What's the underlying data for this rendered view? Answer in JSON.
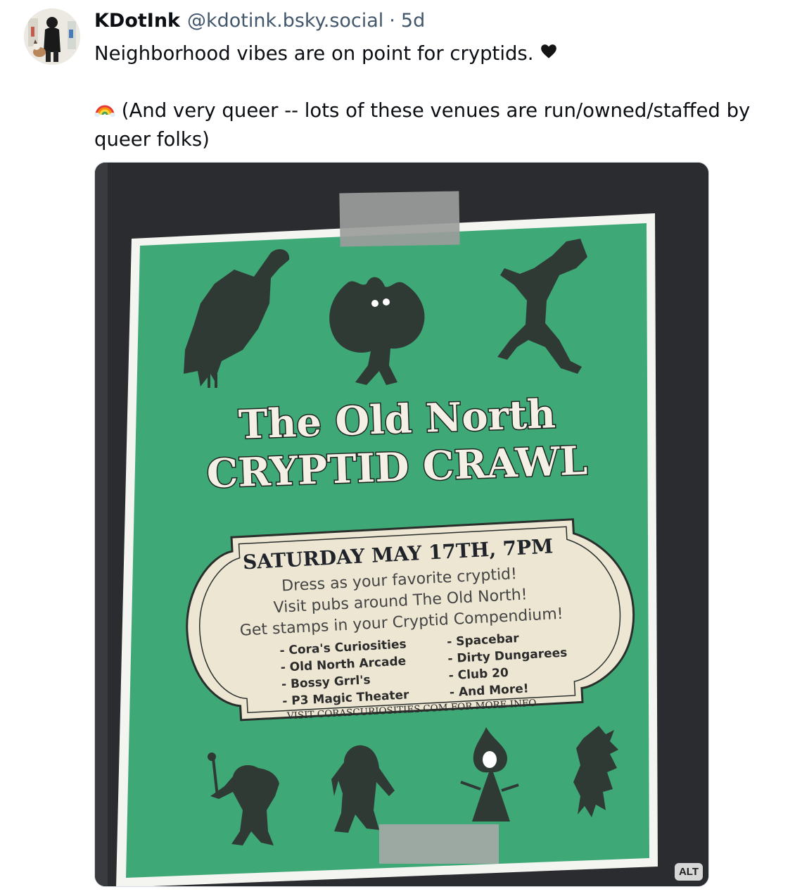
{
  "post": {
    "author_name": "KDotInk",
    "author_handle": "@kdotink.bsky.social",
    "separator": "·",
    "timestamp": "5d",
    "lines": [
      "Neighborhood vibes are on point for cryptids.",
      "(And very queer -- lots of these venues are run/owned/staffed by",
      "queer folks)"
    ],
    "heart_emoji_icon": "black-heart-icon",
    "rainbow_emoji_icon": "rainbow-icon"
  },
  "image": {
    "alt_badge": "ALT",
    "poster": {
      "title_line1": "The Old North",
      "title_line2": "CRYPTID CRAWL",
      "date_line": "SATURDAY MAY 17TH, 7PM",
      "lines": [
        "Dress as your favorite cryptid!",
        "Visit pubs around The Old North!",
        "Get stamps in your Cryptid Compendium!"
      ],
      "venues_left": [
        "- Cora's Curiosities",
        "- Old North Arcade",
        "- Bossy Grrl's",
        "- P3 Magic Theater"
      ],
      "venues_right": [
        "- Spacebar",
        "- Dirty Dungarees",
        "- Club 20",
        "- And More!"
      ],
      "footer": "VISIT CORASCURIOSITIES.COM FOR MORE INFO"
    },
    "colors": {
      "poster_green": "#3fa877",
      "silhouette": "#2f3a35",
      "board": "#2a2b2e",
      "label_bg": "#ece6d3"
    }
  }
}
